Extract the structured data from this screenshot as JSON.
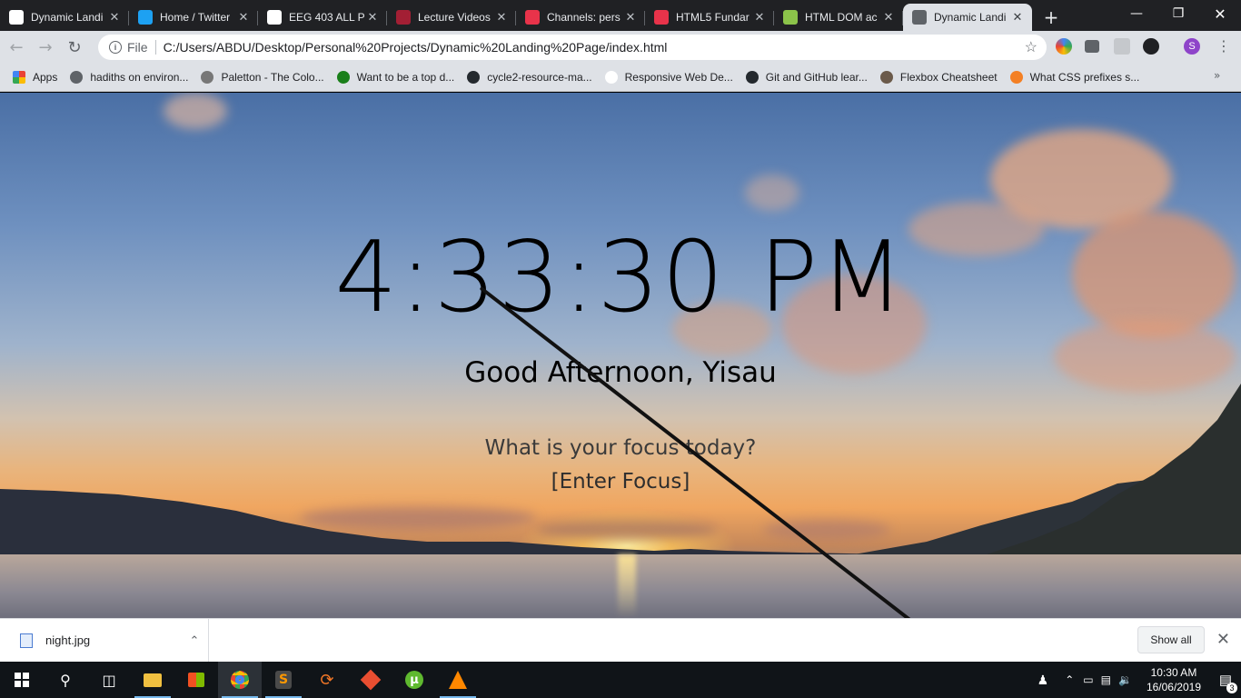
{
  "browser": {
    "tabs": [
      {
        "label": "Dynamic Landi",
        "active": false,
        "color": "#ffffff"
      },
      {
        "label": "Home / Twitter",
        "active": false,
        "color": "#1da1f2"
      },
      {
        "label": "EEG 403 ALL P",
        "active": false,
        "color": "#ffffff"
      },
      {
        "label": "Lecture Videos",
        "active": false,
        "color": "#a31f34"
      },
      {
        "label": "Channels: pers",
        "active": false,
        "color": "#e8334a"
      },
      {
        "label": "HTML5 Fundar",
        "active": false,
        "color": "#e8334a"
      },
      {
        "label": "HTML DOM ac",
        "active": false,
        "color": "#8bc34a"
      },
      {
        "label": "Dynamic Landi",
        "active": true,
        "color": "#5f6368"
      }
    ],
    "address": {
      "scheme_label": "File",
      "url": "C:/Users/ABDU/Desktop/Personal%20Projects/Dynamic%20Landing%20Page/index.html"
    },
    "profile_initial": "S",
    "bookmarks": [
      {
        "label": "Apps",
        "color": "#ea4335"
      },
      {
        "label": "hadiths on environ...",
        "color": "#5f6368"
      },
      {
        "label": "Paletton - The Colo...",
        "color": "#777777"
      },
      {
        "label": "Want to be a top d...",
        "color": "#1a7f1a"
      },
      {
        "label": "cycle2-resource-ma...",
        "color": "#24292e"
      },
      {
        "label": "Responsive Web De...",
        "color": "#ffffff"
      },
      {
        "label": "Git and GitHub lear...",
        "color": "#24292e"
      },
      {
        "label": "Flexbox Cheatsheet",
        "color": "#6b5a4a"
      },
      {
        "label": "What CSS prefixes s...",
        "color": "#f48024"
      }
    ]
  },
  "page": {
    "time": "4:33:30 PM",
    "greeting": "Good Afternoon, Yisau",
    "focus_question": "What is your focus today?",
    "focus_value": "[Enter Focus]"
  },
  "downloads": {
    "file_name": "night.jpg",
    "show_all_label": "Show all"
  },
  "taskbar": {
    "time": "10:30 AM",
    "date": "16/06/2019",
    "notification_count": "3"
  }
}
